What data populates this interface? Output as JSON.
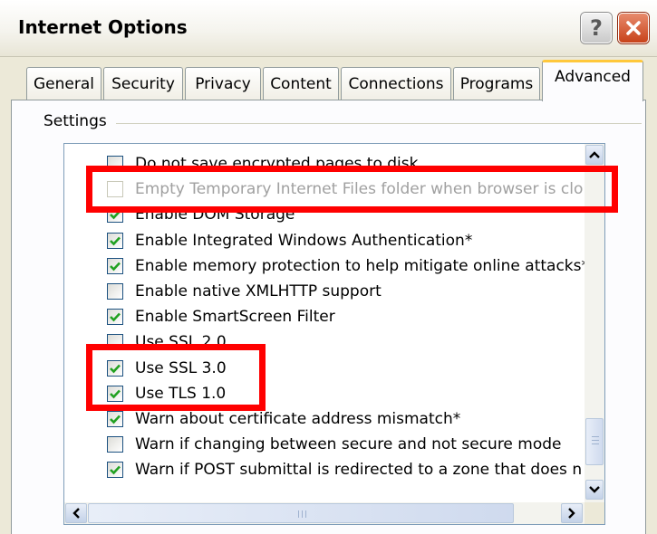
{
  "window": {
    "title": "Internet Options",
    "help_glyph": "?",
    "colors": {
      "highlight": "#ff0000",
      "active_tab_accent": "#ffc83c",
      "dialog_bg": "#ece9d8"
    }
  },
  "tabs": [
    {
      "label": "General",
      "active": false
    },
    {
      "label": "Security",
      "active": false
    },
    {
      "label": "Privacy",
      "active": false
    },
    {
      "label": "Content",
      "active": false
    },
    {
      "label": "Connections",
      "active": false
    },
    {
      "label": "Programs",
      "active": false
    },
    {
      "label": "Advanced",
      "active": true
    }
  ],
  "settings": {
    "group_label": "Settings",
    "items": [
      {
        "label": "Do not save encrypted pages to disk",
        "checked": false,
        "disabled": false
      },
      {
        "label": "Empty Temporary Internet Files folder when browser is clo",
        "checked": false,
        "disabled": true
      },
      {
        "label": "Enable DOM Storage",
        "checked": true,
        "disabled": false
      },
      {
        "label": "Enable Integrated Windows Authentication*",
        "checked": true,
        "disabled": false
      },
      {
        "label": "Enable memory protection to help mitigate online attacks*",
        "checked": true,
        "disabled": false
      },
      {
        "label": "Enable native XMLHTTP support",
        "checked": false,
        "disabled": false
      },
      {
        "label": "Enable SmartScreen Filter",
        "checked": true,
        "disabled": false
      },
      {
        "label": "Use SSL 2.0",
        "checked": false,
        "disabled": false
      },
      {
        "label": "Use SSL 3.0",
        "checked": true,
        "disabled": false
      },
      {
        "label": "Use TLS 1.0",
        "checked": true,
        "disabled": false
      },
      {
        "label": "Warn about certificate address mismatch*",
        "checked": true,
        "disabled": false
      },
      {
        "label": "Warn if changing between secure and not secure mode",
        "checked": false,
        "disabled": false
      },
      {
        "label": "Warn if POST submittal is redirected to a zone that does n",
        "checked": true,
        "disabled": false
      }
    ]
  },
  "scrollbars": {
    "vertical": {
      "position": 0.95
    },
    "horizontal": {
      "position": 0.0
    }
  }
}
